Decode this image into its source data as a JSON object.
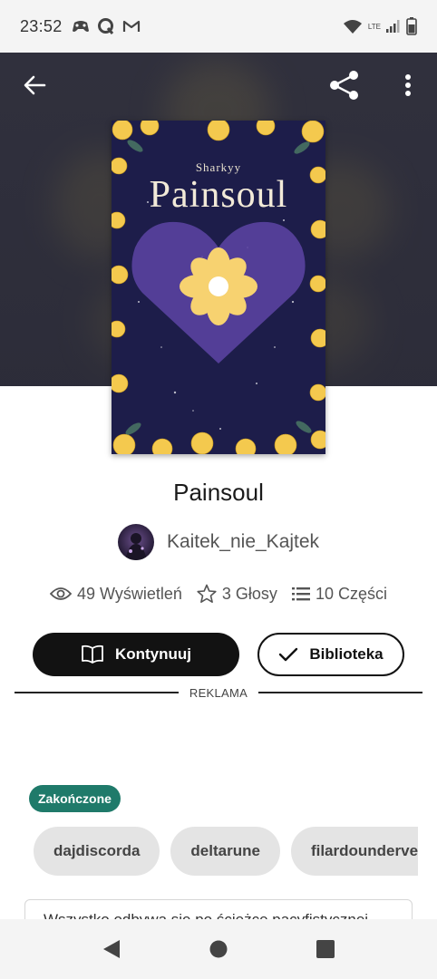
{
  "status_bar": {
    "time": "23:52",
    "network": "LTE"
  },
  "book": {
    "cover_author": "Sharkyy",
    "cover_title": "Painsoul",
    "title": "Painsoul",
    "author": "Kaitek_nie_Kajtek"
  },
  "stats": {
    "views": "49 Wyświetleń",
    "votes": "3 Głosy",
    "parts": "10 Części"
  },
  "actions": {
    "continue_label": "Kontynuuj",
    "library_label": "Biblioteka"
  },
  "ad": {
    "label": "REKLAMA"
  },
  "status_badge": "Zakończone",
  "tags": [
    "dajdiscorda",
    "deltarune",
    "filardoundervers"
  ],
  "description": "Wszystko odbywa się po ścieżce pacyfistycznej",
  "icons": {
    "back": "arrow-left-icon",
    "share": "share-icon",
    "more": "more-vert-icon",
    "views": "eye-icon",
    "votes": "star-icon",
    "parts": "list-icon",
    "continue": "book-open-icon",
    "library": "check-icon"
  },
  "colors": {
    "primary_button": "#121212",
    "badge": "#1f7a6a",
    "tag_bg": "#e4e4e4"
  }
}
